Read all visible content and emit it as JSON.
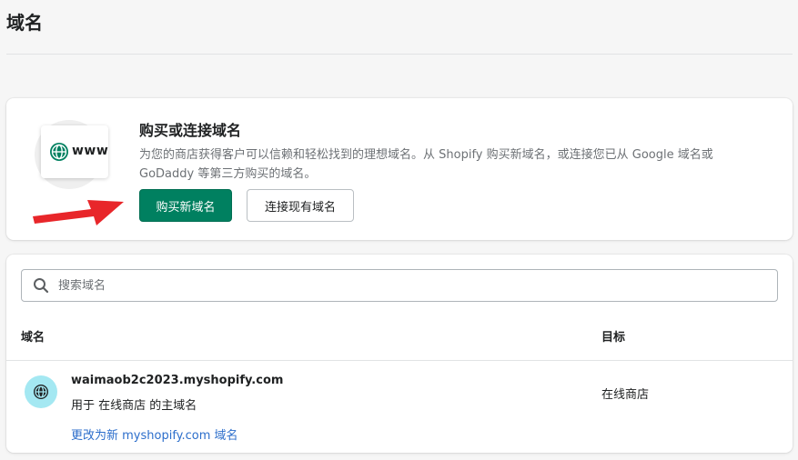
{
  "page": {
    "title": "域名"
  },
  "connect_card": {
    "illustration_text": "www",
    "title": "购买或连接域名",
    "description": "为您的商店获得客户可以信赖和轻松找到的理想域名。从 Shopify 购买新域名，或连接您已从 Google 域名或 GoDaddy 等第三方购买的域名。",
    "buy_button": "购买新域名",
    "connect_button": "连接现有域名",
    "accent_color": "#008060"
  },
  "domains_card": {
    "search_placeholder": "搜索域名",
    "columns": {
      "domain": "域名",
      "target": "目标"
    },
    "rows": [
      {
        "domain": "waimaob2c2023.myshopify.com",
        "subtitle": "用于 在线商店 的主域名",
        "link": "更改为新 myshopify.com 域名",
        "target": "在线商店",
        "icon": "globe-icon"
      }
    ]
  },
  "annotation": {
    "arrow_color": "#e8262a"
  }
}
